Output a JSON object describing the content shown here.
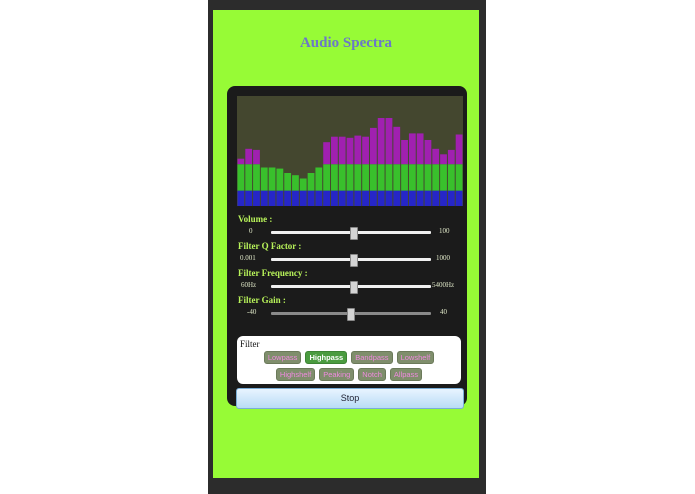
{
  "app": {
    "title": "Audio Spectra"
  },
  "spectrum": {
    "levels": [
      0.43,
      0.52,
      0.51,
      0.35,
      0.35,
      0.34,
      0.3,
      0.28,
      0.25,
      0.3,
      0.35,
      0.58,
      0.63,
      0.63,
      0.62,
      0.64,
      0.63,
      0.71,
      0.8,
      0.8,
      0.72,
      0.6,
      0.66,
      0.66,
      0.6,
      0.52,
      0.47,
      0.51,
      0.65
    ],
    "colors": {
      "low": "#2626c8",
      "mid": "#39c02c",
      "high": "#a020b0"
    }
  },
  "sliders": [
    {
      "label": "Volume :",
      "min": "0",
      "max": "100",
      "value": 0.52,
      "enabled": true
    },
    {
      "label": "Filter Q Factor :",
      "min": "0.001",
      "max": "1000",
      "value": 0.52,
      "enabled": true
    },
    {
      "label": "Filter Frequency :",
      "min": "60Hz",
      "max": "5400Hz",
      "value": 0.52,
      "enabled": true
    },
    {
      "label": "Filter Gain :",
      "min": "-40",
      "max": "40",
      "value": 0.5,
      "enabled": false
    }
  ],
  "filter": {
    "legend": "Filter",
    "row1": [
      "Lowpass",
      "Highpass",
      "Bandpass",
      "Lowshelf"
    ],
    "row2": [
      "Highshelf",
      "Peaking",
      "Notch",
      "Allpass"
    ],
    "selected": "Highpass"
  },
  "controls": {
    "stop_label": "Stop"
  }
}
